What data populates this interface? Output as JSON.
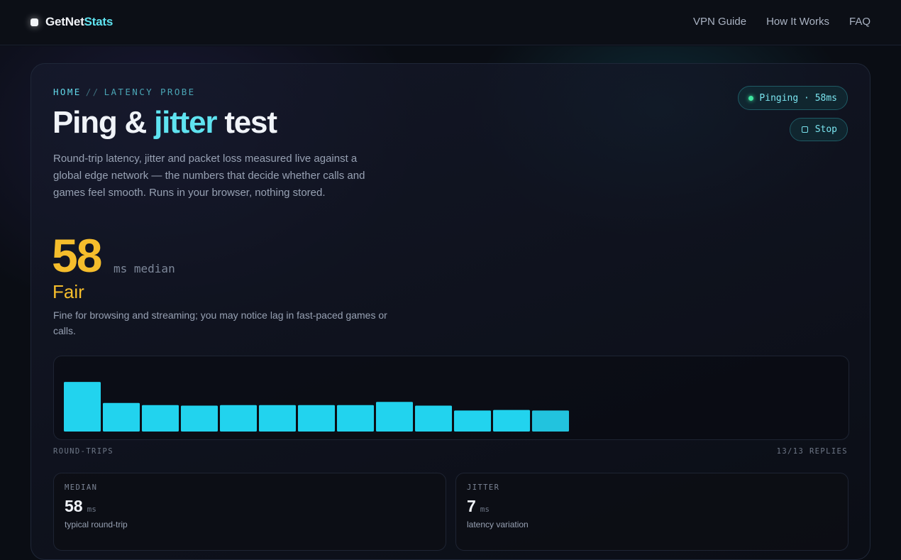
{
  "header": {
    "brand_a": "GetNet",
    "brand_b": "Stats",
    "nav": [
      "VPN Guide",
      "How It Works",
      "FAQ"
    ]
  },
  "hero": {
    "crumb_home": "HOME",
    "crumb_sep": "//",
    "crumb_page": "LATENCY PROBE",
    "title_a": "Ping & ",
    "title_accent": "jitter",
    "title_b": " test",
    "description": "Round-trip latency, jitter and packet loss measured live against a global edge network — the numbers that decide whether calls and games feel smooth. Runs in your browser, nothing stored."
  },
  "status": {
    "pill": "Pinging · 58ms",
    "stop_label": "Stop"
  },
  "result": {
    "median": "58",
    "unit": "ms median",
    "rating": "Fair",
    "rating_note": "Fine for browsing and streaming; you may notice lag in fast-paced games or calls."
  },
  "chart_caption_left": "ROUND-TRIPS",
  "chart_caption_right": "13/13 REPLIES",
  "chart_data": {
    "type": "bar",
    "values": [
      92,
      53,
      49,
      48,
      49,
      49,
      49,
      49,
      55,
      48,
      39,
      40,
      39
    ],
    "ylim": [
      0,
      100
    ],
    "color": "#22d3ee",
    "last_color": "#22c3de"
  },
  "stats": [
    {
      "label": "MEDIAN",
      "value": "58",
      "unit": "ms",
      "sub": "typical round-trip"
    },
    {
      "label": "JITTER",
      "value": "7",
      "unit": "ms",
      "sub": "latency variation"
    }
  ]
}
